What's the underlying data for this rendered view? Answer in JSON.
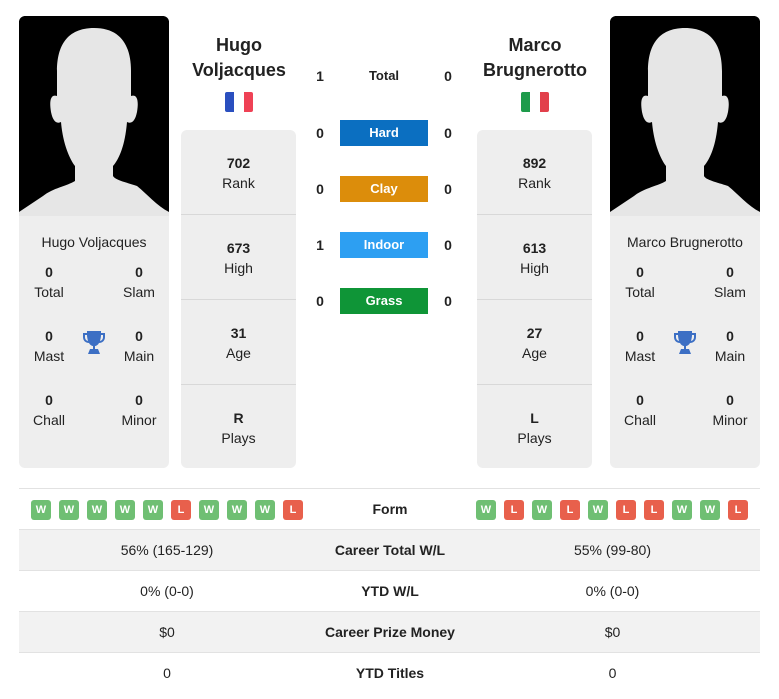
{
  "player1": {
    "name_line1": "Hugo",
    "name_line2": "Voljacques",
    "full_name": "Hugo Voljacques",
    "flag": {
      "country": "France",
      "colors": [
        "#2a4fbf",
        "#ffffff",
        "#ef4155"
      ]
    },
    "stats": [
      {
        "value": "702",
        "label": "Rank"
      },
      {
        "value": "673",
        "label": "High"
      },
      {
        "value": "31",
        "label": "Age"
      },
      {
        "value": "R",
        "label": "Plays"
      }
    ],
    "titles": {
      "total": {
        "value": "0",
        "label": "Total"
      },
      "slam": {
        "value": "0",
        "label": "Slam"
      },
      "mast": {
        "value": "0",
        "label": "Mast"
      },
      "main": {
        "value": "0",
        "label": "Main"
      },
      "chall": {
        "value": "0",
        "label": "Chall"
      },
      "minor": {
        "value": "0",
        "label": "Minor"
      }
    },
    "form": [
      "W",
      "W",
      "W",
      "W",
      "W",
      "L",
      "W",
      "W",
      "W",
      "L"
    ]
  },
  "player2": {
    "name_line1": "Marco",
    "name_line2": "Brugnerotto",
    "full_name": "Marco Brugnerotto",
    "flag": {
      "country": "Italy",
      "colors": [
        "#1e9b4b",
        "#ffffff",
        "#e2404b"
      ]
    },
    "stats": [
      {
        "value": "892",
        "label": "Rank"
      },
      {
        "value": "613",
        "label": "High"
      },
      {
        "value": "27",
        "label": "Age"
      },
      {
        "value": "L",
        "label": "Plays"
      }
    ],
    "titles": {
      "total": {
        "value": "0",
        "label": "Total"
      },
      "slam": {
        "value": "0",
        "label": "Slam"
      },
      "mast": {
        "value": "0",
        "label": "Mast"
      },
      "main": {
        "value": "0",
        "label": "Main"
      },
      "chall": {
        "value": "0",
        "label": "Chall"
      },
      "minor": {
        "value": "0",
        "label": "Minor"
      }
    },
    "form": [
      "W",
      "L",
      "W",
      "L",
      "W",
      "L",
      "L",
      "W",
      "W",
      "L"
    ]
  },
  "h2h": {
    "total": {
      "label": "Total",
      "p1": "1",
      "p2": "0"
    },
    "surfaces": [
      {
        "label": "Hard",
        "p1": "0",
        "p2": "0",
        "color": "#0b6fc1"
      },
      {
        "label": "Clay",
        "p1": "0",
        "p2": "0",
        "color": "#dc8d0b"
      },
      {
        "label": "Indoor",
        "p1": "1",
        "p2": "0",
        "color": "#2d9ff2"
      },
      {
        "label": "Grass",
        "p1": "0",
        "p2": "0",
        "color": "#0f9537"
      }
    ]
  },
  "comparison": {
    "form_label": "Form",
    "rows": [
      {
        "label": "Career Total W/L",
        "p1": "56% (165-129)",
        "p2": "55% (99-80)"
      },
      {
        "label": "YTD W/L",
        "p1": "0% (0-0)",
        "p2": "0% (0-0)"
      },
      {
        "label": "Career Prize Money",
        "p1": "$0",
        "p2": "$0"
      },
      {
        "label": "YTD Titles",
        "p1": "0",
        "p2": "0"
      }
    ]
  },
  "icons": {
    "trophy": "trophy-icon",
    "avatar": "player-silhouette"
  },
  "colors": {
    "win": "#6fbf73",
    "loss": "#e8604c",
    "trophy": "#3c6fc4",
    "card_bg": "#eeeeee"
  }
}
